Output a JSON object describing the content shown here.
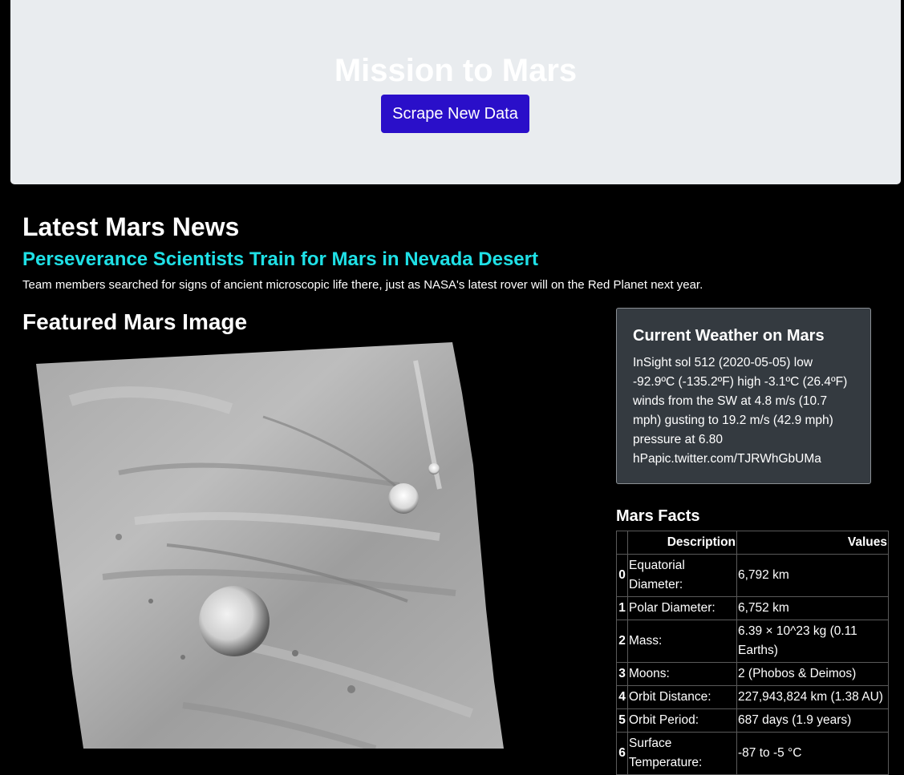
{
  "header": {
    "title": "Mission to Mars",
    "scrape_button_label": "Scrape New Data"
  },
  "news": {
    "heading": "Latest Mars News",
    "title": "Perseverance Scientists Train for Mars in Nevada Desert",
    "teaser": "Team members searched for signs of ancient microscopic life there, just as NASA's latest rover will on the Red Planet next year."
  },
  "featured_image": {
    "heading": "Featured Mars Image"
  },
  "weather": {
    "heading": "Current Weather on Mars",
    "text": "InSight sol 512 (2020-05-05) low -92.9ºC (-135.2ºF) high -3.1ºC (26.4ºF) winds from the SW at 4.8 m/s (10.7 mph) gusting to 19.2 m/s (42.9 mph) pressure at 6.80 hPapic.twitter.com/TJRWhGbUMa"
  },
  "facts": {
    "heading": "Mars Facts",
    "columns": [
      "Description",
      "Values"
    ],
    "rows": [
      {
        "index": "0",
        "description": "Equatorial Diameter:",
        "value": "6,792 km"
      },
      {
        "index": "1",
        "description": "Polar Diameter:",
        "value": "6,752 km"
      },
      {
        "index": "2",
        "description": "Mass:",
        "value": "6.39 × 10^23 kg (0.11 Earths)"
      },
      {
        "index": "3",
        "description": "Moons:",
        "value": "2 (Phobos & Deimos)"
      },
      {
        "index": "4",
        "description": "Orbit Distance:",
        "value": "227,943,824 km (1.38 AU)"
      },
      {
        "index": "5",
        "description": "Orbit Period:",
        "value": "687 days (1.9 years)"
      },
      {
        "index": "6",
        "description": "Surface Temperature:",
        "value": "-87 to -5 °C"
      }
    ]
  }
}
